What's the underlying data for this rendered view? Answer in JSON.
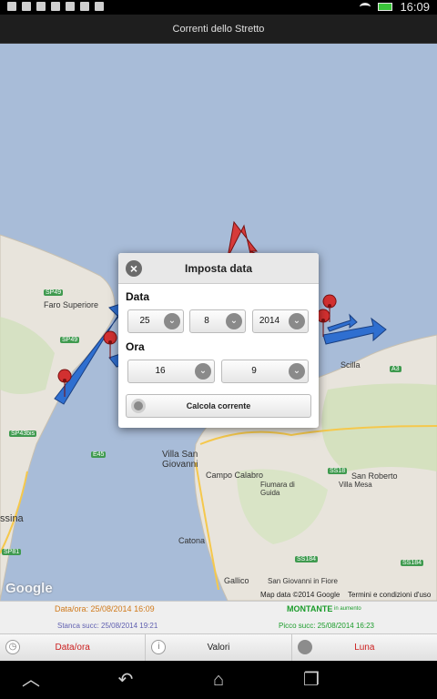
{
  "status": {
    "time": "16:09"
  },
  "app": {
    "title": "Correnti dello Stretto"
  },
  "map": {
    "towns": [
      "Faro Superiore",
      "Villa San Giovanni",
      "Scilla",
      "Campo Calabro",
      "Fiumara di Guida",
      "San Roberto",
      "Villa Mesa",
      "Gallico",
      "Catona",
      "San Giovanni in Fiore",
      "ssina"
    ],
    "roads": [
      "SP49",
      "SP49",
      "SP43bis",
      "SP81",
      "SS18",
      "E45",
      "A3",
      "SS184",
      "SS184"
    ],
    "credit": "Map data ©2014 Google",
    "terms": "Termini e condizioni d'uso",
    "logo": "Google"
  },
  "dialog": {
    "title": "Imposta data",
    "date_label": "Data",
    "day": "25",
    "month": "8",
    "year": "2014",
    "time_label": "Ora",
    "hour": "16",
    "minute": "9",
    "calc_button": "Calcola corrente"
  },
  "info": {
    "dataora": "Data/ora: 25/08/2014 16:09",
    "stanca": "Stanca succ: 25/08/2014 19:21",
    "montante": "MONTANTE",
    "montante_sub": "in aumento",
    "picco": "Picco succ: 25/08/2014 16:23"
  },
  "tabs": [
    {
      "label": "Data/ora",
      "color": "#cc1f1f"
    },
    {
      "label": "Valori",
      "color": "#222222"
    },
    {
      "label": "Luna",
      "color": "#cc1f1f"
    }
  ],
  "colors": {
    "arrow_blue": "#2f6fd0",
    "arrow_red": "#d63a3a",
    "water": "#a8bcd8",
    "land": "#e8e4dc"
  }
}
